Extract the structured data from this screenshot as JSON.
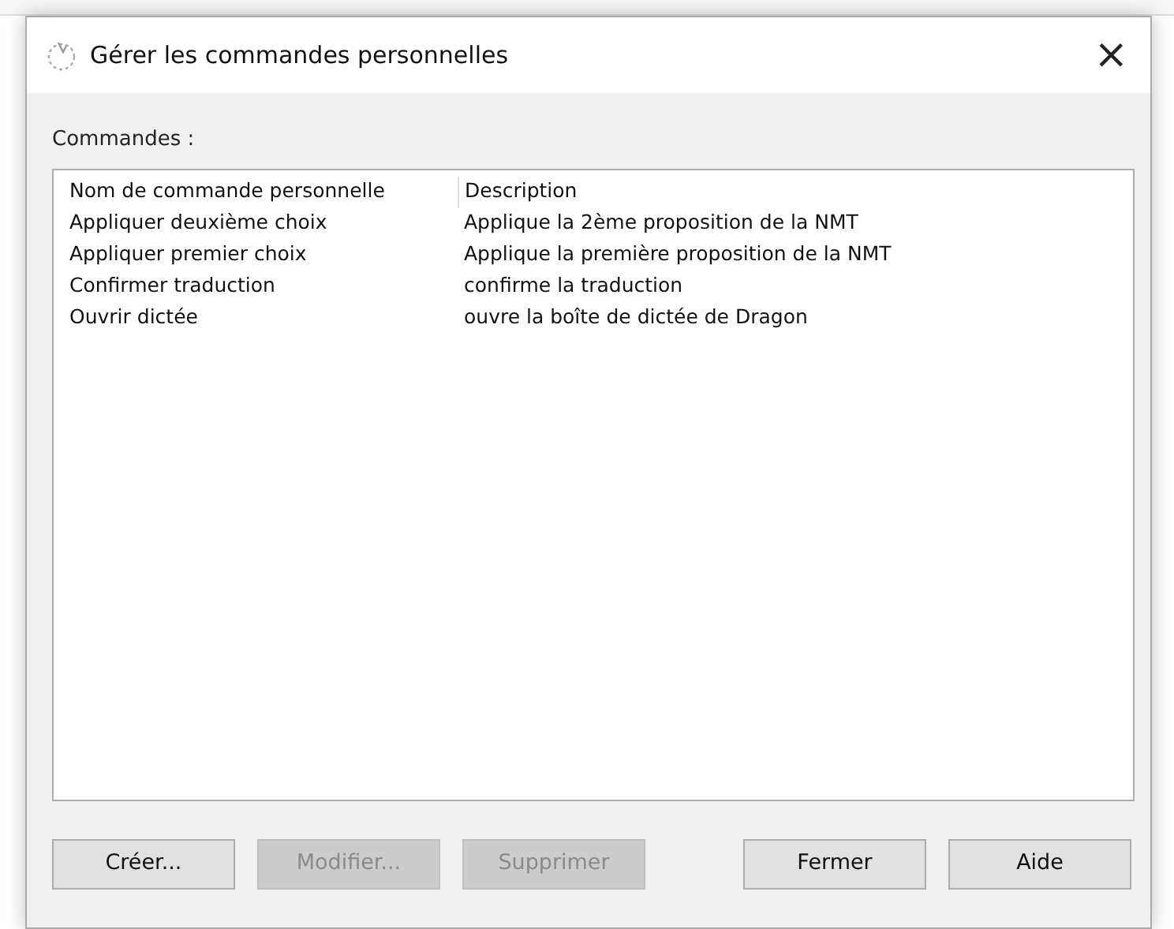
{
  "window": {
    "title": "Gérer les commandes personnelles",
    "close": "×"
  },
  "list_label": "Commandes :",
  "table": {
    "columns": [
      "Nom de commande personnelle",
      "Description"
    ],
    "rows": [
      {
        "cells": [
          "Appliquer deuxième choix",
          "Applique la 2ème proposition de la NMT"
        ]
      },
      {
        "cells": [
          "Appliquer premier choix",
          "Applique la première proposition de la NMT"
        ]
      },
      {
        "cells": [
          "Confirmer traduction",
          "confirme la traduction"
        ]
      },
      {
        "cells": [
          "Ouvrir dictée",
          "ouvre la boîte de dictée de Dragon"
        ]
      }
    ]
  },
  "buttons_left": [
    {
      "label": "Créer...",
      "disabled": false
    },
    {
      "label": "Modifier...",
      "disabled": true
    },
    {
      "label": "Supprimer",
      "disabled": true
    }
  ],
  "buttons_right": [
    {
      "label": "Fermer",
      "disabled": false
    },
    {
      "label": "Aide",
      "disabled": false
    }
  ]
}
